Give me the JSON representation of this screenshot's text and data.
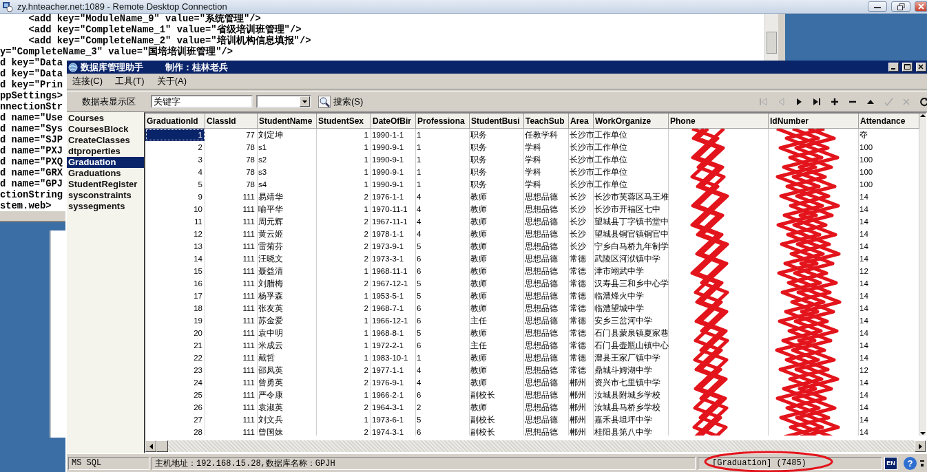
{
  "remote_window": {
    "title": "zy.hnteacher.net:1089 - Remote Desktop Connection"
  },
  "editor_lines": [
    "     <add key=\"ModuleName_9\" value=\"系统管理\"/>",
    "     <add key=\"CompleteName_1\" value=\"省级培训班管理\"/>",
    "     <add key=\"CompleteName_2\" value=\"培训机构信息填报\"/>",
    "y=\"CompleteName_3\" value=\"国培培训班管理\"/>",
    "d key=\"Data",
    "d key=\"Data",
    "d key=\"Prin",
    "ppSettings>",
    "nnectionStr",
    "d name=\"Use",
    "d name=\"Sys",
    "d name=\"SJP",
    "d name=\"PXJ",
    "d name=\"PXQ",
    "d name=\"GRX",
    "d name=\"GPJ",
    "ctionString",
    "stem.web>"
  ],
  "app": {
    "title": "数据库管理助手",
    "author": "制作：桂林老兵",
    "menu": [
      {
        "label": "连接(C)"
      },
      {
        "label": "工具(T)"
      },
      {
        "label": "关于(A)"
      }
    ],
    "toolbar": {
      "label": "数据表显示区",
      "keyword": {
        "value": "关键字"
      },
      "search_button": "搜索(S)",
      "nav_buttons": [
        {
          "kind": "first",
          "disabled": true
        },
        {
          "kind": "prev",
          "disabled": true
        },
        {
          "kind": "next",
          "disabled": false
        },
        {
          "kind": "last",
          "disabled": false
        },
        {
          "kind": "add",
          "disabled": false
        },
        {
          "kind": "remove",
          "disabled": false
        },
        {
          "kind": "up",
          "disabled": false
        },
        {
          "kind": "confirm",
          "disabled": true
        },
        {
          "kind": "cancel",
          "disabled": true
        },
        {
          "kind": "refresh",
          "disabled": false
        }
      ]
    },
    "tables": [
      {
        "name": "Courses",
        "selected": false
      },
      {
        "name": "CoursesBlock",
        "selected": false
      },
      {
        "name": "CreateClasses",
        "selected": false
      },
      {
        "name": "dtproperties",
        "selected": false
      },
      {
        "name": "Graduation",
        "selected": true
      },
      {
        "name": "Graduations",
        "selected": false
      },
      {
        "name": "StudentRegister",
        "selected": false
      },
      {
        "name": "sysconstraints",
        "selected": false
      },
      {
        "name": "syssegments",
        "selected": false
      }
    ],
    "grid": {
      "columns": [
        {
          "label": "GraduationId",
          "kind": "number"
        },
        {
          "label": "ClassId",
          "kind": "number"
        },
        {
          "label": "StudentName",
          "kind": "text"
        },
        {
          "label": "StudentSex",
          "kind": "number"
        },
        {
          "label": "DateOfBir",
          "kind": "text"
        },
        {
          "label": "Professiona",
          "kind": "text"
        },
        {
          "label": "StudentBusi",
          "kind": "text"
        },
        {
          "label": "TeachSub",
          "kind": "text"
        },
        {
          "label": "Area",
          "kind": "text"
        },
        {
          "label": "WorkOrganize",
          "kind": "text"
        },
        {
          "label": "Phone",
          "kind": "text",
          "redacted": true
        },
        {
          "label": "IdNumber",
          "kind": "text",
          "redacted": true
        },
        {
          "label": "Attendance",
          "kind": "text"
        }
      ],
      "rows": [
        {
          "selected": true,
          "cells": [
            "1",
            "77",
            "刘定坤",
            "1",
            "1990-1-1",
            "1",
            "职务",
            "任教学科",
            "长沙市",
            "工作单位",
            "夺"
          ]
        },
        {
          "selected": false,
          "cells": [
            "2",
            "78",
            "s1",
            "1",
            "1990-9-1",
            "1",
            "职务",
            "学科",
            "长沙市",
            "工作单位",
            "100"
          ]
        },
        {
          "selected": false,
          "cells": [
            "3",
            "78",
            "s2",
            "1",
            "1990-9-1",
            "1",
            "职务",
            "学科",
            "长沙市",
            "工作单位",
            "100"
          ]
        },
        {
          "selected": false,
          "cells": [
            "4",
            "78",
            "s3",
            "1",
            "1990-9-1",
            "1",
            "职务",
            "学科",
            "长沙市",
            "工作单位",
            "100"
          ]
        },
        {
          "selected": false,
          "cells": [
            "5",
            "78",
            "s4",
            "1",
            "1990-9-1",
            "1",
            "职务",
            "学科",
            "长沙市",
            "工作单位",
            "100"
          ]
        },
        {
          "selected": false,
          "cells": [
            "9",
            "111",
            "易靖华",
            "2",
            "1976-1-1",
            "4",
            "教师",
            "思想品德",
            "长沙",
            "长沙市芙蓉区马王堆",
            "14"
          ]
        },
        {
          "selected": false,
          "cells": [
            "10",
            "111",
            "喻平华",
            "1",
            "1970-11-1",
            "4",
            "教师",
            "思想品德",
            "长沙",
            "长沙市开福区七中",
            "14"
          ]
        },
        {
          "selected": false,
          "cells": [
            "11",
            "111",
            "周元辉",
            "2",
            "1967-11-1",
            "4",
            "教师",
            "思想品德",
            "长沙",
            "望城县丁字镇书堂中",
            "14"
          ]
        },
        {
          "selected": false,
          "cells": [
            "12",
            "111",
            "黄云姬",
            "2",
            "1978-1-1",
            "4",
            "教师",
            "思想品德",
            "长沙",
            "望城县铜官镇铜官中",
            "14"
          ]
        },
        {
          "selected": false,
          "cells": [
            "13",
            "111",
            "雷菊芬",
            "2",
            "1973-9-1",
            "5",
            "教师",
            "思想品德",
            "长沙",
            "宁乡白马桥九年制学",
            "14"
          ]
        },
        {
          "selected": false,
          "cells": [
            "14",
            "111",
            "汪晓文",
            "2",
            "1973-3-1",
            "6",
            "教师",
            "思想品德",
            "常德",
            "武陵区河洑镇中学",
            "14"
          ]
        },
        {
          "selected": false,
          "cells": [
            "15",
            "111",
            "聂益清",
            "1",
            "1968-11-1",
            "6",
            "教师",
            "思想品德",
            "常德",
            "津市翊武中学",
            "12"
          ]
        },
        {
          "selected": false,
          "cells": [
            "16",
            "111",
            "刘腊梅",
            "2",
            "1967-12-1",
            "5",
            "教师",
            "思想品德",
            "常德",
            "汉寿县三和乡中心学",
            "14"
          ]
        },
        {
          "selected": false,
          "cells": [
            "17",
            "111",
            "杨孚森",
            "1",
            "1953-5-1",
            "5",
            "教师",
            "思想品德",
            "常德",
            "临澧烽火中学",
            "14"
          ]
        },
        {
          "selected": false,
          "cells": [
            "18",
            "111",
            "张友英",
            "2",
            "1968-7-1",
            "6",
            "教师",
            "思想品德",
            "常德",
            "临澧望城中学",
            "14"
          ]
        },
        {
          "selected": false,
          "cells": [
            "19",
            "111",
            "苏金爱",
            "1",
            "1966-12-1",
            "6",
            "主任",
            "思想品德",
            "常德",
            "安乡三岔河中学",
            "14"
          ]
        },
        {
          "selected": false,
          "cells": [
            "20",
            "111",
            "袁中明",
            "1",
            "1968-8-1",
            "5",
            "教师",
            "思想品德",
            "常德",
            "石门县蒙泉镇夏家巷",
            "14"
          ]
        },
        {
          "selected": false,
          "cells": [
            "21",
            "111",
            "米成云",
            "1",
            "1972-2-1",
            "6",
            "主任",
            "思想品德",
            "常德",
            "石门县壶瓶山镇中心",
            "14"
          ]
        },
        {
          "selected": false,
          "cells": [
            "22",
            "111",
            "戴哲",
            "1",
            "1983-10-1",
            "1",
            "教师",
            "思想品德",
            "常德",
            "澧县王家厂镇中学",
            "14"
          ]
        },
        {
          "selected": false,
          "cells": [
            "23",
            "111",
            "邵凤英",
            "2",
            "1977-1-1",
            "4",
            "教师",
            "思想品德",
            "常德",
            "鼎城斗姆湖中学",
            "12"
          ]
        },
        {
          "selected": false,
          "cells": [
            "24",
            "111",
            "曾勇英",
            "2",
            "1976-9-1",
            "4",
            "教师",
            "思想品德",
            "郴州",
            "资兴市七里镇中学",
            "14"
          ]
        },
        {
          "selected": false,
          "cells": [
            "25",
            "111",
            "严令康",
            "1",
            "1966-2-1",
            "6",
            "副校长",
            "思想品德",
            "郴州",
            "汝城县附城乡学校",
            "14"
          ]
        },
        {
          "selected": false,
          "cells": [
            "26",
            "111",
            "袁淑英",
            "2",
            "1964-3-1",
            "2",
            "教师",
            "思想品德",
            "郴州",
            "汝城县马桥乡学校",
            "14"
          ]
        },
        {
          "selected": false,
          "cells": [
            "27",
            "111",
            "刘文兵",
            "1",
            "1973-6-1",
            "5",
            "副校长",
            "思想品德",
            "郴州",
            "嘉禾县坦坪中学",
            "14"
          ]
        },
        {
          "selected": false,
          "cells": [
            "28",
            "111",
            "曾国妹",
            "2",
            "1974-3-1",
            "6",
            "副校长",
            "思想品德",
            "郴州",
            "桂阳县第八中学",
            "14"
          ]
        }
      ]
    },
    "status_bar": {
      "provider": "MS SQL",
      "host": "主机地址：192.168.15.28,数据库名称：GPJH",
      "record": "[Graduation] (7485)",
      "ime": "EN",
      "help": "?"
    }
  }
}
